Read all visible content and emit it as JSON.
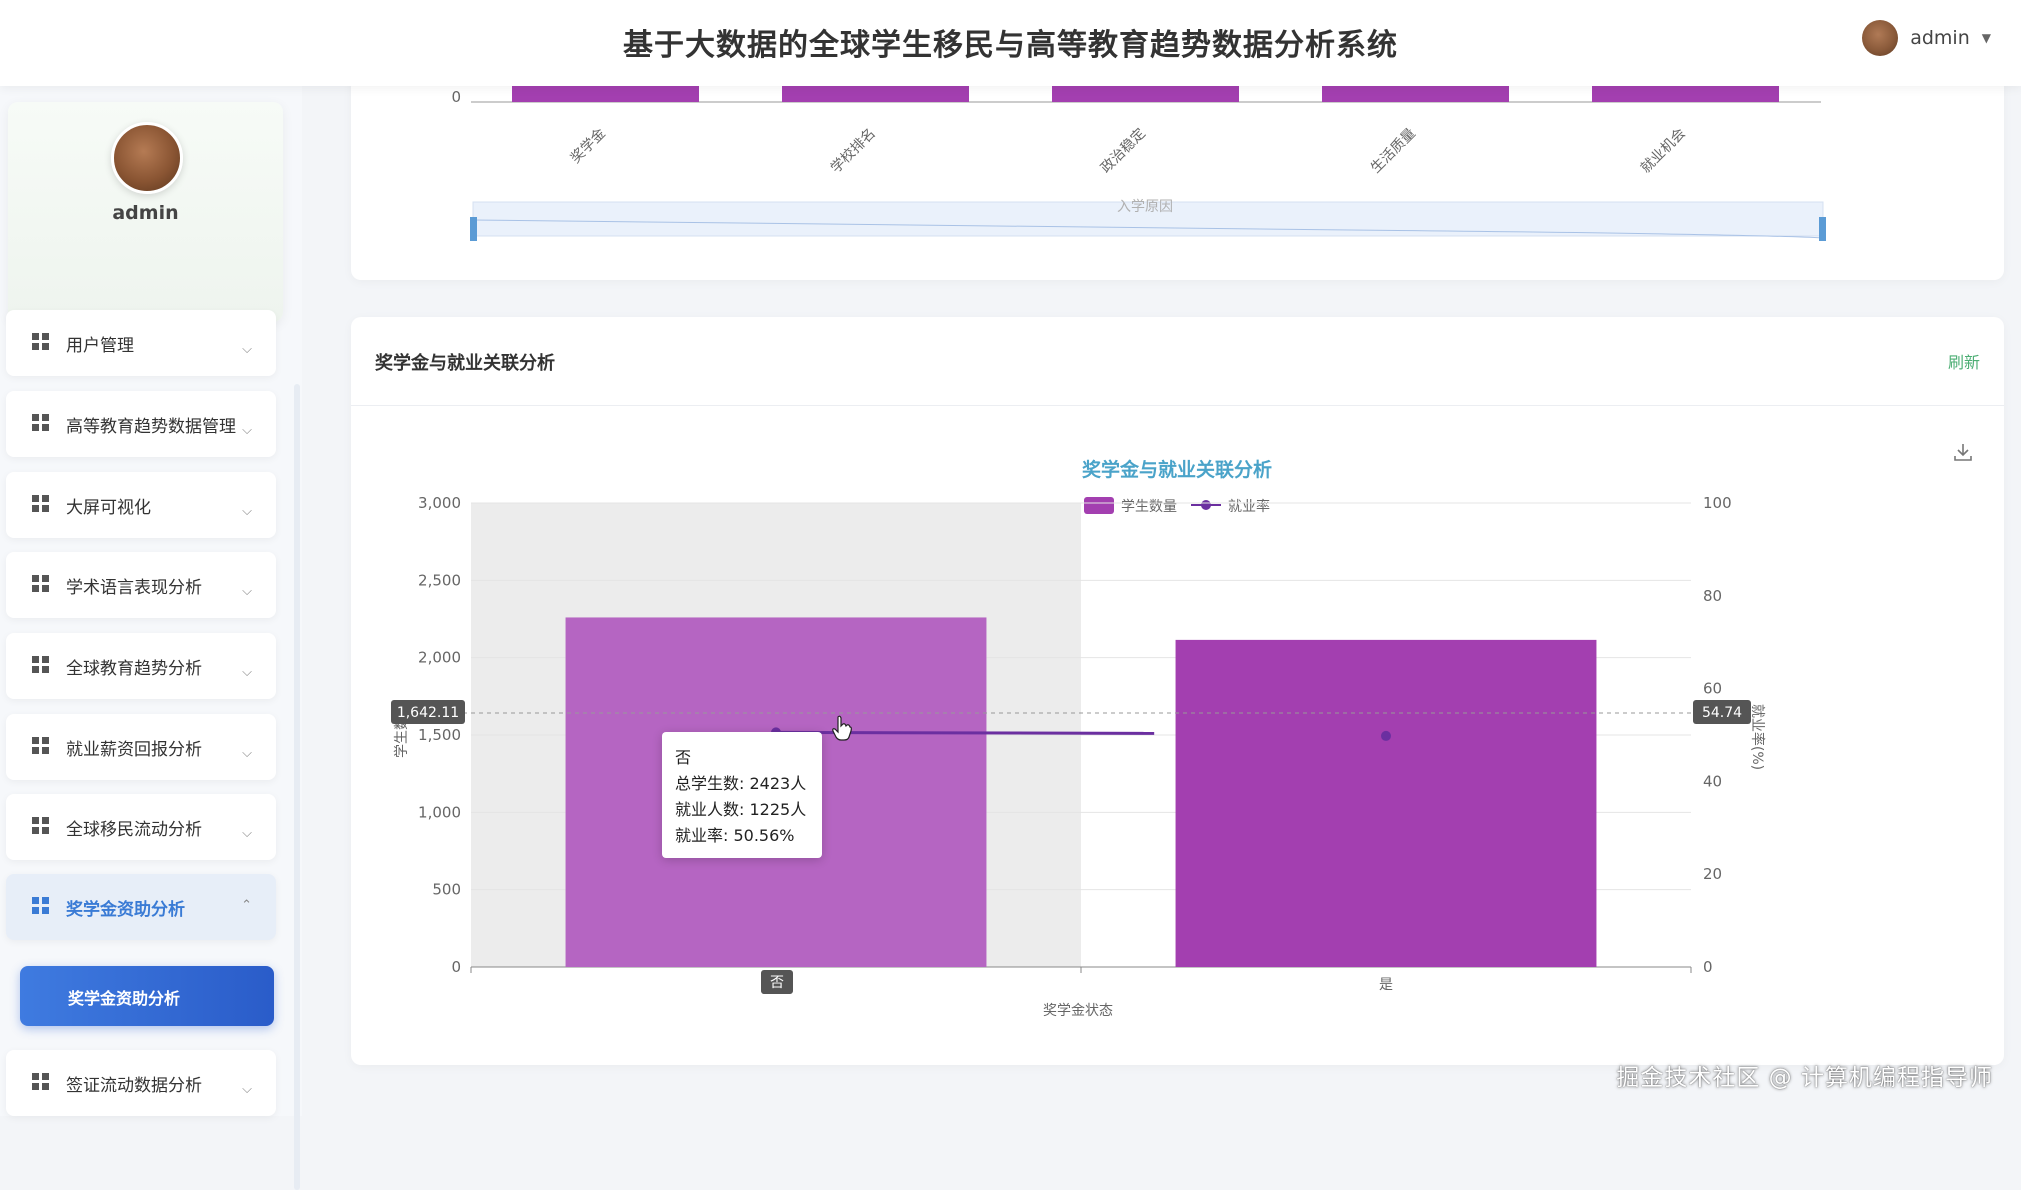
{
  "header": {
    "title": "基于大数据的全球学生移民与高等教育趋势数据分析系统",
    "user": "admin"
  },
  "sidebar": {
    "profile_name": "admin",
    "items": [
      {
        "label": "用户管理"
      },
      {
        "label": "高等教育趋势数据管理"
      },
      {
        "label": "大屏可视化"
      },
      {
        "label": "学术语言表现分析"
      },
      {
        "label": "全球教育趋势分析"
      },
      {
        "label": "就业薪资回报分析"
      },
      {
        "label": "全球移民流动分析"
      },
      {
        "label": "奖学金资助分析"
      },
      {
        "label": "签证流动数据分析"
      }
    ],
    "active_submenu": "奖学金资助分析"
  },
  "top_chart": {
    "y_zero": "0",
    "categories": [
      "奖学金",
      "学校排名",
      "政治稳定",
      "生活质量",
      "就业机会"
    ],
    "datazoom_label": "入学原因"
  },
  "card": {
    "title": "奖学金与就业关联分析",
    "refresh": "刷新"
  },
  "chart_data": {
    "type": "bar",
    "title": "奖学金与就业关联分析",
    "categories": [
      "否",
      "是"
    ],
    "series": [
      {
        "name": "学生数量",
        "type": "bar",
        "axis": "left",
        "values": [
          2260,
          2115
        ],
        "color": "#a33fb0"
      },
      {
        "name": "就业率",
        "type": "line",
        "axis": "right",
        "values": [
          50.56,
          49.8
        ],
        "color": "#6b2fa0"
      }
    ],
    "xlabel": "奖学金状态",
    "ylabel_left": "学生数",
    "ylabel_right": "就业率(%)",
    "ylim_left": [
      0,
      3000
    ],
    "ylim_right": [
      0,
      100
    ],
    "yticks_left": [
      "0",
      "500",
      "1,000",
      "1,500",
      "2,000",
      "2,500",
      "3,000"
    ],
    "yticks_right": [
      "0",
      "20",
      "40",
      "60",
      "80",
      "100"
    ],
    "pointer": {
      "left_value": "1,642.11",
      "right_value": "54.74",
      "x_label": "否"
    },
    "legend_position": "top-center",
    "grid": true
  },
  "tooltip": {
    "title": "否",
    "line1": "总学生数: 2423人",
    "line2": "就业人数: 1225人",
    "line3": "就业率: 50.56%"
  },
  "watermark": "掘金技术社区 @ 计算机编程指导师"
}
